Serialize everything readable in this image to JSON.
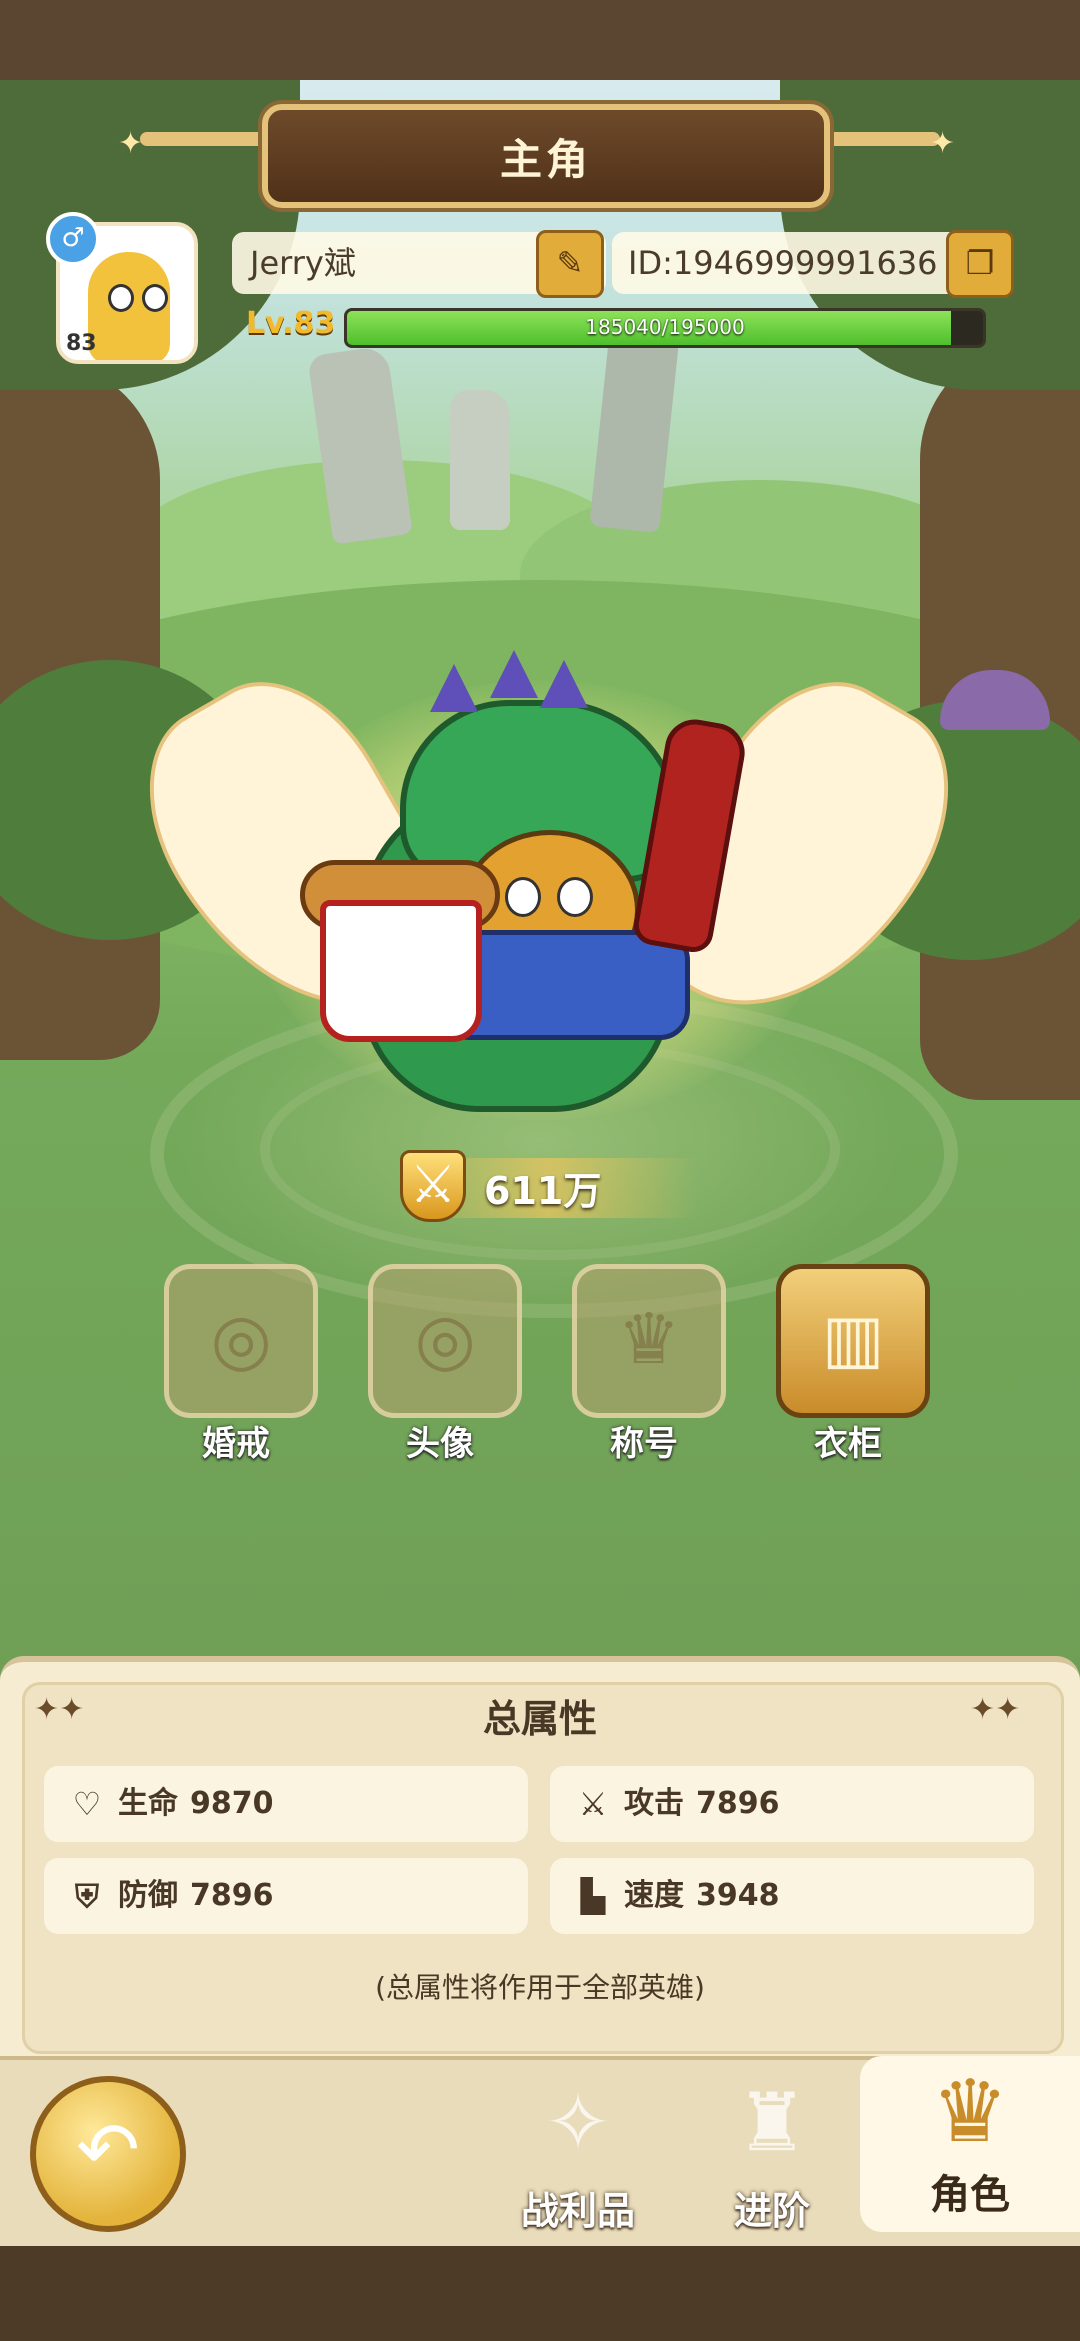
{
  "title": "主角",
  "profile": {
    "gender_icon": "♂",
    "avatar_level": "83",
    "name": "Jerry斌",
    "id_text": "ID:1946999991636",
    "level_label": "Lv.83",
    "xp_text": "185040/195000",
    "xp_fraction": 0.949
  },
  "hero": {
    "power": "611万"
  },
  "functions": [
    {
      "label": "婚戒",
      "icon": "ring-icon",
      "active": false
    },
    {
      "label": "头像",
      "icon": "portrait-icon",
      "active": false
    },
    {
      "label": "称号",
      "icon": "title-badge-icon",
      "active": false
    },
    {
      "label": "衣柜",
      "icon": "wardrobe-icon",
      "active": true
    }
  ],
  "attributes": {
    "title": "总属性",
    "stats": [
      {
        "label": "生命",
        "value": "9870",
        "icon": "heart-icon"
      },
      {
        "label": "攻击",
        "value": "7896",
        "icon": "attack-icon"
      },
      {
        "label": "防御",
        "value": "7896",
        "icon": "shield-icon"
      },
      {
        "label": "速度",
        "value": "3948",
        "icon": "boot-icon"
      }
    ],
    "note": "(总属性将作用于全部英雄)"
  },
  "nav": {
    "loot": "战利品",
    "advance": "进阶",
    "role": "角色"
  },
  "colors": {
    "accent_gold": "#e2ac3a",
    "xp_green": "#4fbf2c",
    "panel_bg": "#f6ecd2"
  }
}
